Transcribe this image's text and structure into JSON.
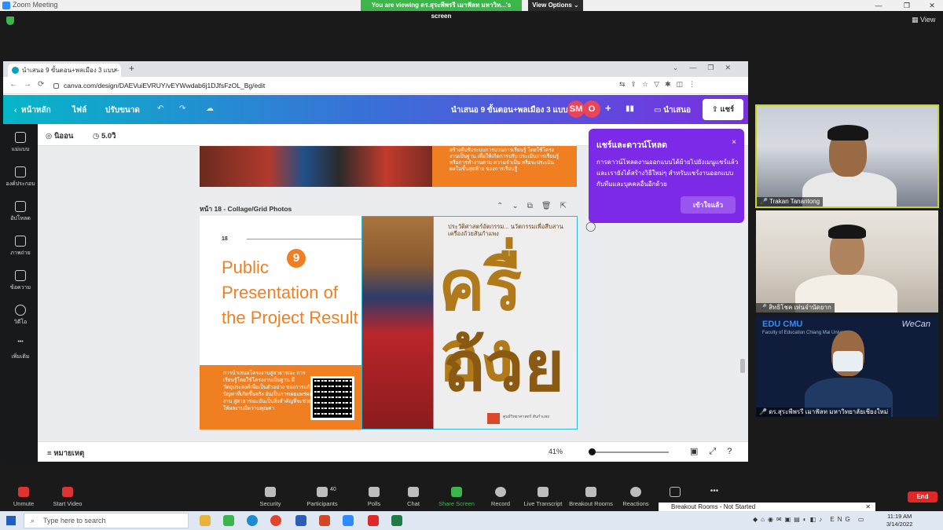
{
  "zoom": {
    "window_title": "Zoom Meeting",
    "viewing_banner": "You are viewing ดร.สุระพีพรรี เมาฟัลท มหาวิท...'s screen",
    "view_options": "View Options ⌄",
    "view_button": "View",
    "toolbar": [
      {
        "label": "Unmute",
        "icon": "mic-muted-icon"
      },
      {
        "label": "Start Video",
        "icon": "video-off-icon"
      },
      {
        "label": "Security",
        "icon": "shield-icon"
      },
      {
        "label": "Participants",
        "icon": "participants-icon",
        "count": "40"
      },
      {
        "label": "Polls",
        "icon": "polls-icon"
      },
      {
        "label": "Chat",
        "icon": "chat-icon"
      },
      {
        "label": "Share Screen",
        "icon": "share-screen-icon"
      },
      {
        "label": "Record",
        "icon": "record-icon"
      },
      {
        "label": "Live Transcript",
        "icon": "cc-icon"
      },
      {
        "label": "Breakout Rooms",
        "icon": "breakout-icon"
      },
      {
        "label": "Reactions",
        "icon": "reactions-icon"
      },
      {
        "label": "",
        "icon": "fullscreen-icon"
      },
      {
        "label": "•••",
        "icon": "more-icon"
      }
    ],
    "end_label": "End",
    "breakout_banner": "Breakout Rooms - Not Started",
    "participants": [
      {
        "name": "Trakan Tanantong"
      },
      {
        "name": "สิทธิโชค เท่นจำนัดยาก"
      },
      {
        "name": "ดร.สุระพีพรรี เมาฟัลท มหาวิทยาลัยเชียงใหม่"
      }
    ],
    "edu_logo": "EDU CMU",
    "edu_sub": "Faculty of Education\nChiang Mai University",
    "wecan": "WeCan"
  },
  "browser": {
    "tab_title": "นำเสนอ 9 ขั้นตอน+พลเมือง 3 แบบ - ...",
    "tab_close": "×",
    "new_tab": "+",
    "url": "canva.com/design/DAEVuiEVRUY/vEYWwdab6j1DJfsFzOL_Bg/edit"
  },
  "canva": {
    "home": "หน้าหลัก",
    "file": "ไฟล์",
    "resize": "ปรับขนาด",
    "doc_title": "นำเสนอ 9 ขั้นตอน+พลเมือง 3 แบบ",
    "avatars": [
      {
        "label": "SM",
        "color": "#e8445a"
      },
      {
        "label": "O",
        "color": "#e8445a"
      }
    ],
    "add": "+",
    "present": "นำเสนอ",
    "share": "แชร์",
    "toolbar_animate": "นิออน",
    "toolbar_time": "5.0วิ",
    "rail": [
      {
        "label": "แม่แบบ",
        "icon": "templates-icon"
      },
      {
        "label": "องค์ประกอบ",
        "icon": "elements-icon"
      },
      {
        "label": "อัปโหลด",
        "icon": "upload-icon"
      },
      {
        "label": "ภาพถ่าย",
        "icon": "photos-icon"
      },
      {
        "label": "ข้อความ",
        "icon": "text-icon"
      },
      {
        "label": "วิดีโอ",
        "icon": "video-icon"
      },
      {
        "label": "เพิ่มเติม",
        "icon": "more-icon"
      }
    ],
    "page17_text": "สร้างคืบรับระบบการบวนการเรียนรู้ โดยใช้โครงงานเป็นฐาน เพื่อให้เกิดการปรับ ประเมินการเรียนรู้หรือการทำงานตาม ความจำเป็น หรือจะประเมินผลในขั้นสุดท้าย ของการเรียนรู้",
    "page_label": "หน้า 18 - Collage/Grid Photos",
    "slide": {
      "number": "18",
      "step": "9",
      "title": "Public Presentation of the Project Result",
      "body": "การนำเสนอโครงงานสู่สาธารณะ การเรียนรู้โดยใช้โครงงานเป็นฐาน มีวัตถุประสงค์เพื่อเป็นตัวอย่าง ของการแก้ปัญหาที่เกิดขึ้นจริง อันเป็นการเผยแพร่ผลงาน สู่สาธารณะอันเป็นสิ่งสำคัญที่จะช่วย ให้ผลงานมีความคุณค่า",
      "poster_heading": "ประวัติศาสตร์อัตกรรม... นวัตกรรมเพื่อสืบสานเครื่องถ้วยสันกำแพง",
      "poster_big1": "ครื่อง",
      "poster_big2": "ถ้วย",
      "poster_logo_text": "ศูนย์วิทยาศาสตร์\nสันกำแพง"
    },
    "popup": {
      "title": "แชร์และดาวน์โหลด",
      "body": "การดาวน์โหลดงานออกแบบได้ย้ายไปยังเมนูแชร์แล้ว และเรายังได้สร้างวิธีใหม่ๆ สำหรับแชร์งานออกแบบกับทีมและบุคคลอื่นอีกด้วย",
      "button": "เข้าใจแล้ว",
      "close": "×"
    },
    "notes": "หมายเหตุ",
    "zoom_level": "41%"
  },
  "taskbar": {
    "search_placeholder": "Type here to search",
    "lang": "ENG",
    "time": "11:19 AM",
    "date": "3/14/2022"
  }
}
